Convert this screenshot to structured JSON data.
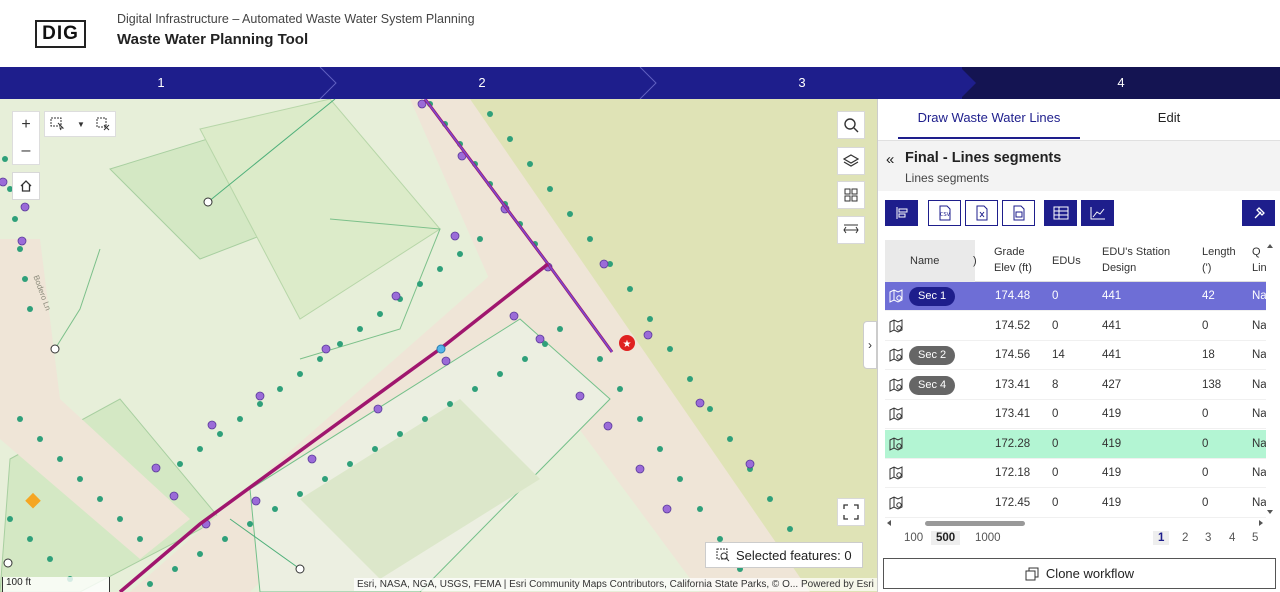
{
  "header": {
    "logo": "DIG",
    "subtitle": "Digital Infrastructure – Automated Waste Water System Planning",
    "title": "Waste Water Planning Tool"
  },
  "stepper": {
    "steps": [
      "1",
      "2",
      "3",
      "4"
    ],
    "active_step": "4"
  },
  "map": {
    "zoom_in": "+",
    "zoom_out": "–",
    "selected_features": "Selected features: 0",
    "attribution": "Esri, NASA, NGA, USGS, FEMA | Esri Community Maps Contributors, California State Parks, © O...",
    "powered_by": "Powered by Esri",
    "scale": "100 ft",
    "street_labels": [
      "Bodero Ln"
    ]
  },
  "panel": {
    "tabs": [
      "Draw Waste Water Lines",
      "Edit"
    ],
    "active_tab": "Draw Waste Water Lines",
    "title": "Final - Lines segments",
    "subtitle": "Lines segments",
    "grid": {
      "columns": [
        "Name",
        ")",
        "Grade Elev (ft)",
        "EDUs",
        "EDU's Station Design",
        "Length (')",
        "Q? Lin"
      ],
      "col_name": "Name",
      "col_prev": ")",
      "col_grade_1": "Grade",
      "col_grade_2": "Elev (ft)",
      "col_edus": "EDUs",
      "col_station_1": "EDU's Station",
      "col_station_2": "Design",
      "col_length_1": "Length",
      "col_length_2": "(')",
      "col_q_1": "Q",
      "col_q_2": "Lin",
      "rows": [
        {
          "name": "Sec 1",
          "grade": "174.48",
          "edus": "0",
          "station": "441",
          "length": "42",
          "q": "Na"
        },
        {
          "name": "",
          "grade": "174.52",
          "edus": "0",
          "station": "441",
          "length": "0",
          "q": "Na"
        },
        {
          "name": "Sec 2",
          "grade": "174.56",
          "edus": "14",
          "station": "441",
          "length": "18",
          "q": "Na"
        },
        {
          "name": "Sec 4",
          "grade": "173.41",
          "edus": "8",
          "station": "427",
          "length": "138",
          "q": "Na"
        },
        {
          "name": "",
          "grade": "173.41",
          "edus": "0",
          "station": "419",
          "length": "0",
          "q": "Na"
        },
        {
          "name": "",
          "grade": "172.28",
          "edus": "0",
          "station": "419",
          "length": "0",
          "q": "Na"
        },
        {
          "name": "",
          "grade": "172.18",
          "edus": "0",
          "station": "419",
          "length": "0",
          "q": "Na"
        },
        {
          "name": "",
          "grade": "172.45",
          "edus": "0",
          "station": "419",
          "length": "0",
          "q": "Na"
        }
      ]
    },
    "page_sizes": [
      "100",
      "500",
      "1000"
    ],
    "active_page_size": "500",
    "pages": [
      "1",
      "2",
      "3",
      "4",
      "5"
    ],
    "active_page": "1",
    "clone_button": "Clone workflow"
  },
  "colors": {
    "primary": "#1e1e8c",
    "selected_row": "#6e6ed6",
    "highlight_row": "#b3f5d3",
    "pipe": "#a0166e"
  }
}
